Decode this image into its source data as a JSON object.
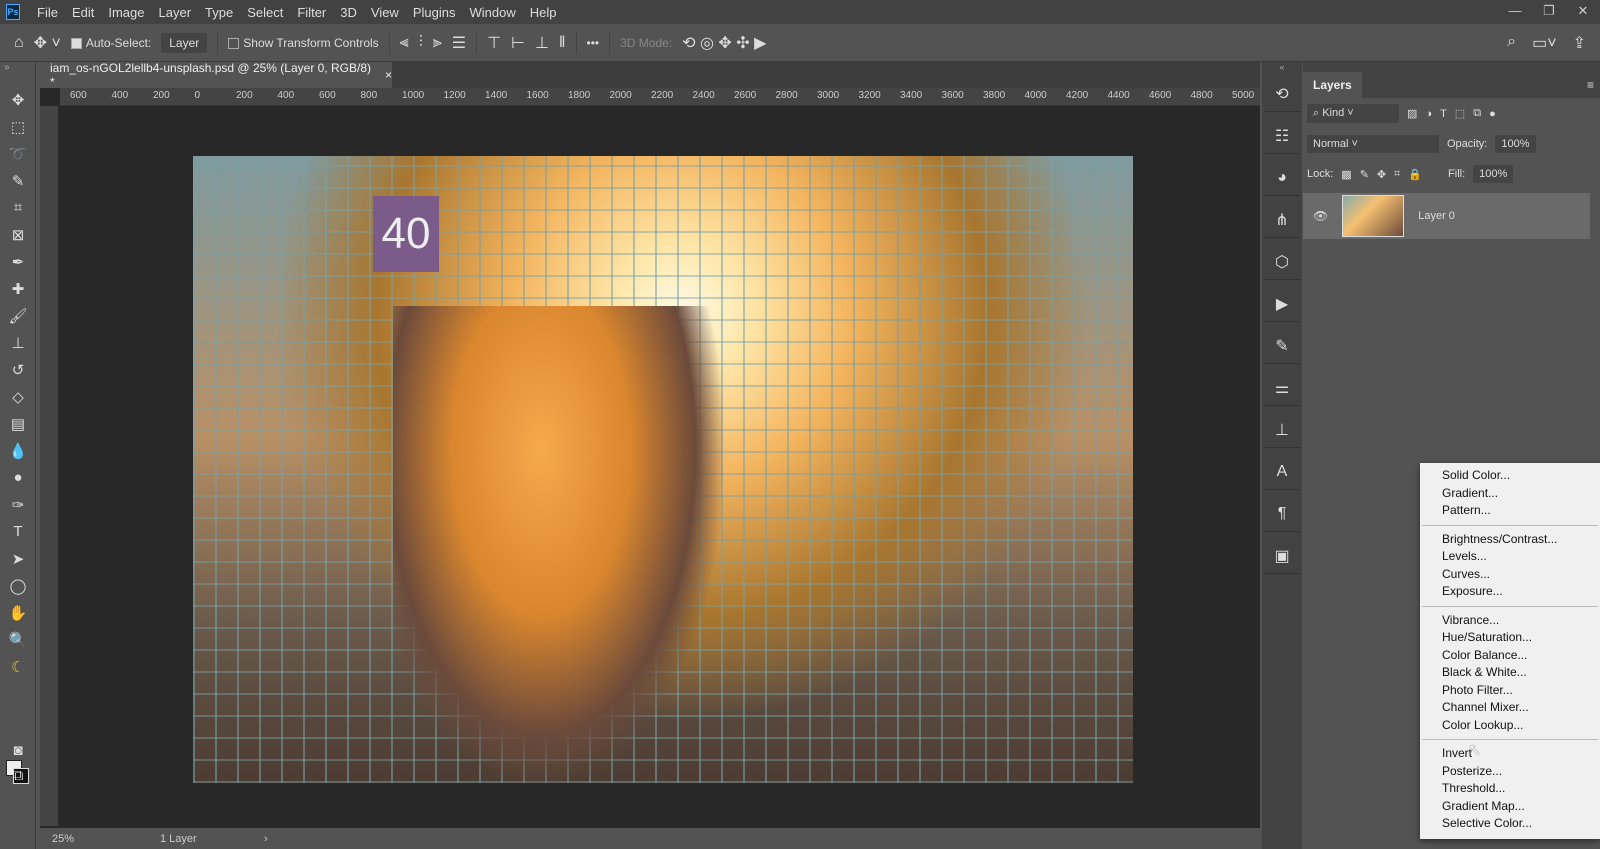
{
  "app": {
    "logo": "Ps"
  },
  "menu": [
    "File",
    "Edit",
    "Image",
    "Layer",
    "Type",
    "Select",
    "Filter",
    "3D",
    "View",
    "Plugins",
    "Window",
    "Help"
  ],
  "options": {
    "auto_select_label": "Auto-Select:",
    "auto_select_checked": true,
    "layer_dropdown": "Layer",
    "show_transform_label": "Show Transform Controls",
    "show_transform_checked": false,
    "more": "•••",
    "mode_3d": "3D Mode:"
  },
  "document": {
    "tab_title": "iam_os-nGOL2lellb4-unsplash.psd @ 25% (Layer 0, RGB/8) *",
    "close": "×",
    "sign_text": "40"
  },
  "ruler": [
    "600",
    "400",
    "200",
    "0",
    "200",
    "400",
    "600",
    "800",
    "1000",
    "1200",
    "1400",
    "1600",
    "1800",
    "2000",
    "2200",
    "2400",
    "2600",
    "2800",
    "3000",
    "3200",
    "3400",
    "3600",
    "3800",
    "4000",
    "4200",
    "4400",
    "4600",
    "4800",
    "5000"
  ],
  "status": {
    "zoom": "25%",
    "info": "1 Layer",
    "arrow": "›"
  },
  "layers_panel": {
    "tab": "Layers",
    "kind": "Kind",
    "blend_mode": "Normal",
    "opacity_label": "Opacity:",
    "opacity": "100%",
    "lock_label": "Lock:",
    "fill_label": "Fill:",
    "fill": "100%",
    "layers": [
      {
        "name": "Layer 0",
        "visible": true
      }
    ]
  },
  "context_menu": {
    "groups": [
      [
        "Solid Color...",
        "Gradient...",
        "Pattern..."
      ],
      [
        "Brightness/Contrast...",
        "Levels...",
        "Curves...",
        "Exposure..."
      ],
      [
        "Vibrance...",
        "Hue/Saturation...",
        "Color Balance...",
        "Black & White...",
        "Photo Filter...",
        "Channel Mixer...",
        "Color Lookup..."
      ],
      [
        "Invert",
        "Posterize...",
        "Threshold...",
        "Gradient Map...",
        "Selective Color..."
      ]
    ]
  }
}
